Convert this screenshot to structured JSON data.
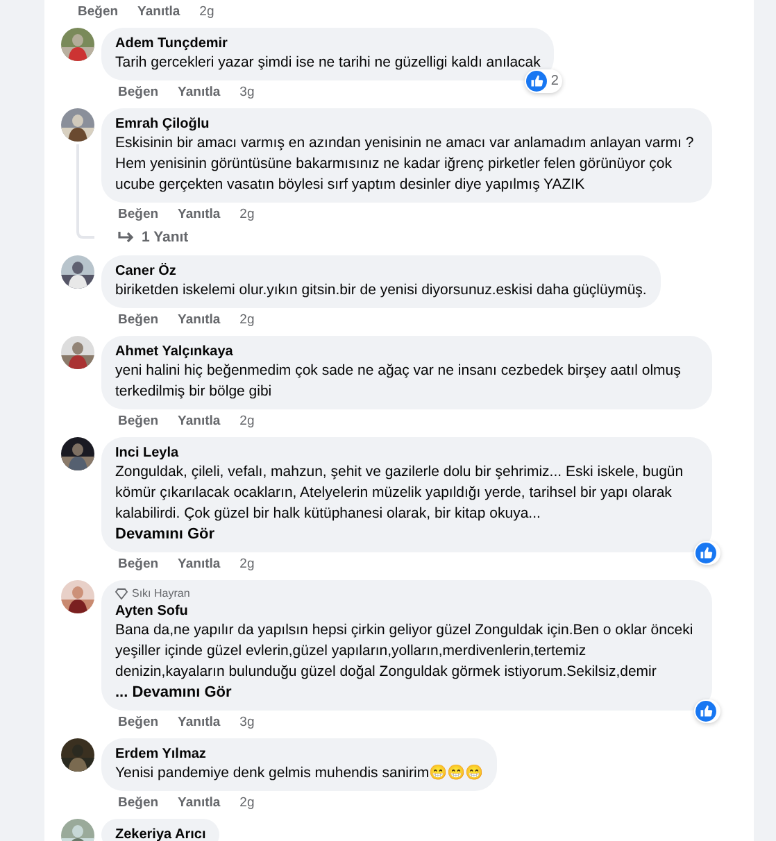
{
  "top_actions": {
    "like": "Beğen",
    "reply": "Yanıtla",
    "time": "2g"
  },
  "comments": [
    {
      "name": "Adem Tunçdemir",
      "text": "Tarih gercekleri yazar şimdi ise ne tarihi ne güzelligi kaldı anılacak",
      "reaction": {
        "kind": "like",
        "count": "2"
      },
      "actions": {
        "like": "Beğen",
        "reply": "Yanıtla",
        "time": "3g"
      }
    },
    {
      "name": "Emrah Çiloğlu",
      "text": "Eskisinin bir amacı varmış en azından yenisinin ne amacı var anlamadım anlayan varmı ? Hem yenisinin görüntüsüne bakarmısınız ne kadar iğrenç pirketler felen görünüyor çok ucube gerçekten vasatın böylesi sırf yaptım desinler diye yapılmış YAZIK",
      "actions": {
        "like": "Beğen",
        "reply": "Yanıtla",
        "time": "2g"
      },
      "replies": "1 Yanıt"
    },
    {
      "name": "Caner Öz",
      "text": "biriketden iskelemi olur.yıkın gitsin.bir de yenisi diyorsunuz.eskisi daha güçlüymüş.",
      "actions": {
        "like": "Beğen",
        "reply": "Yanıtla",
        "time": "2g"
      }
    },
    {
      "name": "Ahmet Yalçınkaya",
      "text": "yeni halini hiç beğenmedim çok sade ne ağaç var ne insanı cezbedek birşey aatıl olmuş terkedilmiş bir bölge gibi",
      "actions": {
        "like": "Beğen",
        "reply": "Yanıtla",
        "time": "2g"
      }
    },
    {
      "name": "Inci Leyla",
      "text": "Zonguldak, çileli, vefalı, mahzun, şehit ve gazilerle dolu bir şehrimiz... Eski iskele, bugün kömür çıkarılacak ocakların, Atelyelerin müzelik yapıldığı yerde, tarihsel bir yapı olarak kalabilirdi. Çok güzel bir halk kütüphanesi olarak, bir kitap okuya...",
      "see_more": "Devamını Gör",
      "reaction": {
        "kind": "like"
      },
      "actions": {
        "like": "Beğen",
        "reply": "Yanıtla",
        "time": "2g"
      }
    },
    {
      "badge": "Sıkı Hayran",
      "name": "Ayten Sofu",
      "text": "Bana da,ne yapılır da yapılsın hepsi çirkin geliyor güzel Zonguldak için.Ben o oklar önceki yeşiller içinde güzel evlerin,güzel yapıların,yolların,merdivenlerin,tertemiz denizin,kayaların bulunduğu güzel doğal Zonguldak görmek istiyorum.Sekilsiz,demir",
      "see_more": "... Devamını Gör",
      "reaction": {
        "kind": "like"
      },
      "actions": {
        "like": "Beğen",
        "reply": "Yanıtla",
        "time": "3g"
      }
    },
    {
      "name": "Erdem Yılmaz",
      "text": "Yenisi pandemiye denk gelmis muhendis sanirim😁😁😁",
      "actions": {
        "like": "Beğen",
        "reply": "Yanıtla",
        "time": "2g"
      }
    },
    {
      "name": "Zekeriya Arıcı"
    }
  ]
}
